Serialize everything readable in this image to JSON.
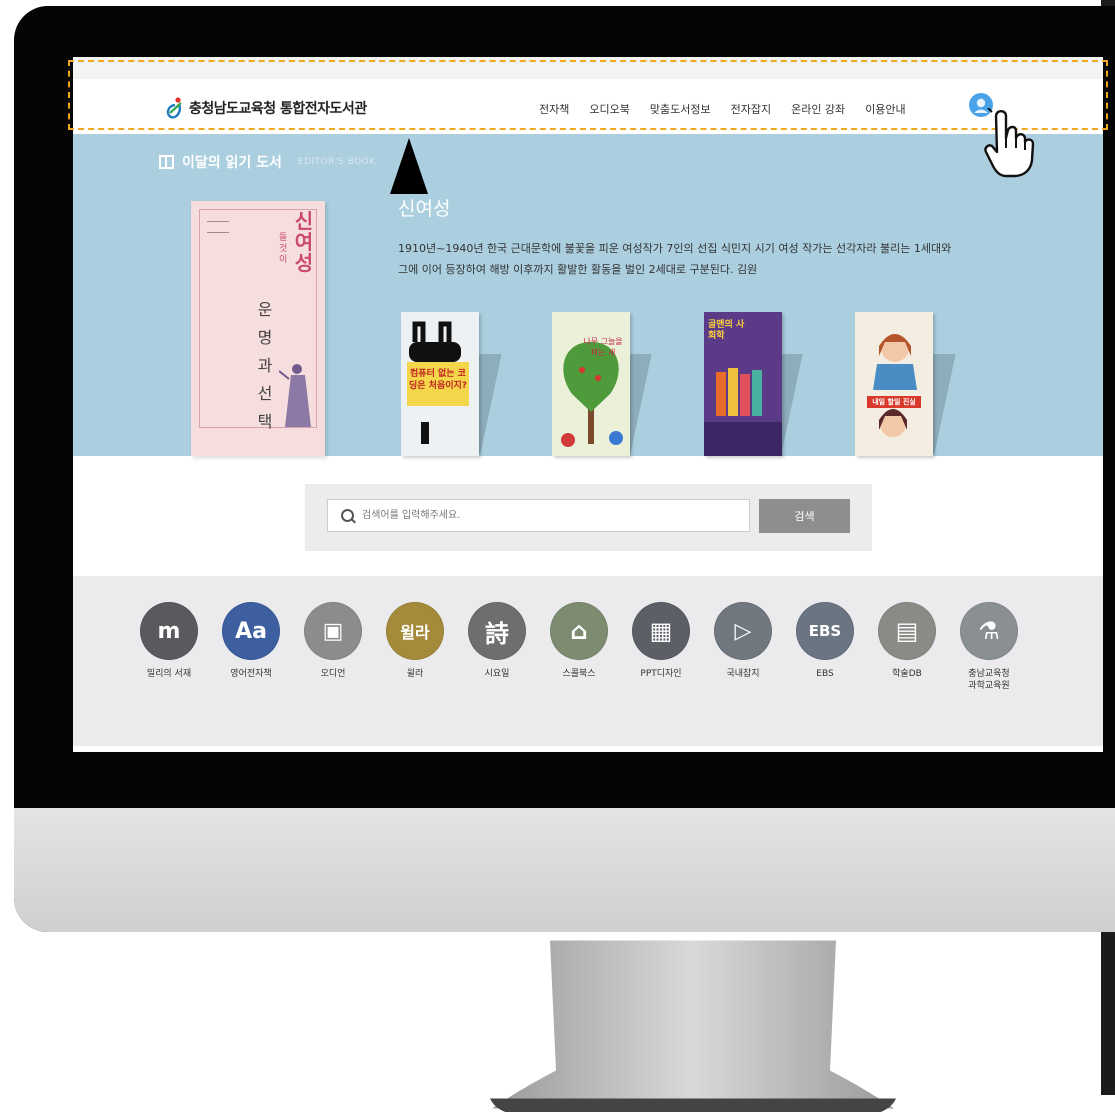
{
  "header": {
    "logo_text": "충청남도교육청 통합전자도서관",
    "nav": [
      "전자책",
      "오디오북",
      "맞춤도서정보",
      "전자잡지",
      "온라인 강좌",
      "이용안내"
    ]
  },
  "hero": {
    "section_title": "이달의 읽기 도서",
    "section_subtitle": "EDITOR'S BOOK",
    "main_book_title": "신여성",
    "main_book_small": "들 것 이",
    "main_book_subtitle": "운명과 선택",
    "featured_name": "신여성",
    "featured_desc": "1910년~1940년 한국 근대문학에 불꽃을 피운 여성작가 7인의 선집 식민지 시기 여성 작가는 선각자라 불리는 1세대와 그에 이어 등장하여 해방 이후까지 활발한 활동을 벌인 2세대로 구분된다. 김원",
    "books": [
      {
        "label": "컴퓨터 없는 코딩은 처음이지?",
        "color": "#eef1f3"
      },
      {
        "label": "나무 그늘을 파는 새",
        "color": "#eaf1d8"
      },
      {
        "label": "골맨의 사회학",
        "color": "#5b3a88"
      },
      {
        "label": "내일 할일 진실",
        "color": "#f3ede2"
      }
    ]
  },
  "search": {
    "placeholder": "검색어를 입력해주세요.",
    "button_label": "검색"
  },
  "services": [
    {
      "label": "밀리의 서재",
      "glyph": "m",
      "color": "#5a5a5e"
    },
    {
      "label": "영어전자책",
      "glyph": "Aa",
      "color": "#3d5fa0"
    },
    {
      "label": "오디언",
      "glyph": "▣",
      "color": "#8c8c8c"
    },
    {
      "label": "윌라",
      "glyph": "윌라",
      "color": "#a48a3a"
    },
    {
      "label": "시요일",
      "glyph": "詩",
      "color": "#6e6e6e"
    },
    {
      "label": "스콜북스",
      "glyph": "⌂",
      "color": "#7d8c70"
    },
    {
      "label": "PPT디자인",
      "glyph": "▦",
      "color": "#5c5f66"
    },
    {
      "label": "국내잡지",
      "glyph": "▷",
      "color": "#70777f"
    },
    {
      "label": "EBS",
      "glyph": "EBS",
      "color": "#6a7482"
    },
    {
      "label": "학술DB",
      "glyph": "▤",
      "color": "#8a8a86"
    },
    {
      "label": "충남교육청\n과학교육원",
      "glyph": "⚗",
      "color": "#8a8f94"
    }
  ]
}
